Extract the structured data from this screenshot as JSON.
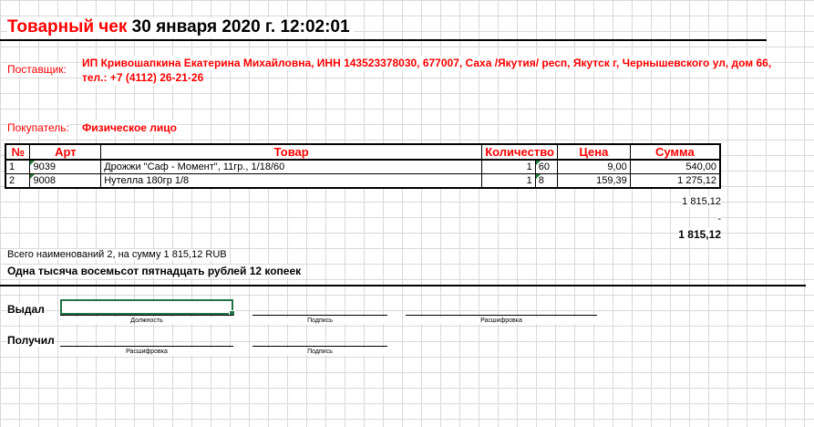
{
  "header": {
    "title_label": "Товарный чек",
    "title_date": "30 января 2020 г. 12:02:01"
  },
  "supplier": {
    "label": "Поставщик:",
    "line1": "ИП Кривошапкина Екатерина Михайловна,  ИНН 143523378030,  677007, Саха /Якутия/ респ, Якутск г, Чернышевского ул, дом 66,",
    "line2": "тел.: +7 (4112) 26-21-26"
  },
  "buyer": {
    "label": "Покупатель:",
    "value": "Физическое лицо"
  },
  "table": {
    "headers": [
      "№",
      "Арт",
      "Товар",
      "Количество",
      "Цена",
      "Сумма"
    ],
    "rows": [
      {
        "num": "1",
        "art": "9039",
        "name": "Дрожжи \"Саф - Момент\", 11гр., 1/18/60",
        "qty": "1",
        "qty2": "60",
        "price": "9,00",
        "sum": "540,00"
      },
      {
        "num": "2",
        "art": "9008",
        "name": "Нутелла 180гр 1/8",
        "qty": "1",
        "qty2": "8",
        "price": "159,39",
        "sum": "1 275,12"
      }
    ]
  },
  "totals": {
    "total": "1 815,12",
    "vat": "-",
    "grand_total": "1 815,12"
  },
  "summary": {
    "line": "Всего наименований 2, на сумму 1 815,12 RUB",
    "words": "Одна тысяча восемьсот пятнадцать рублей 12 копеек"
  },
  "signatures": {
    "issued_label": "Выдал",
    "received_label": "Получил",
    "position_caption": "Должность",
    "signature_caption": "Подпись",
    "decoding_caption": "Расшифровка"
  }
}
